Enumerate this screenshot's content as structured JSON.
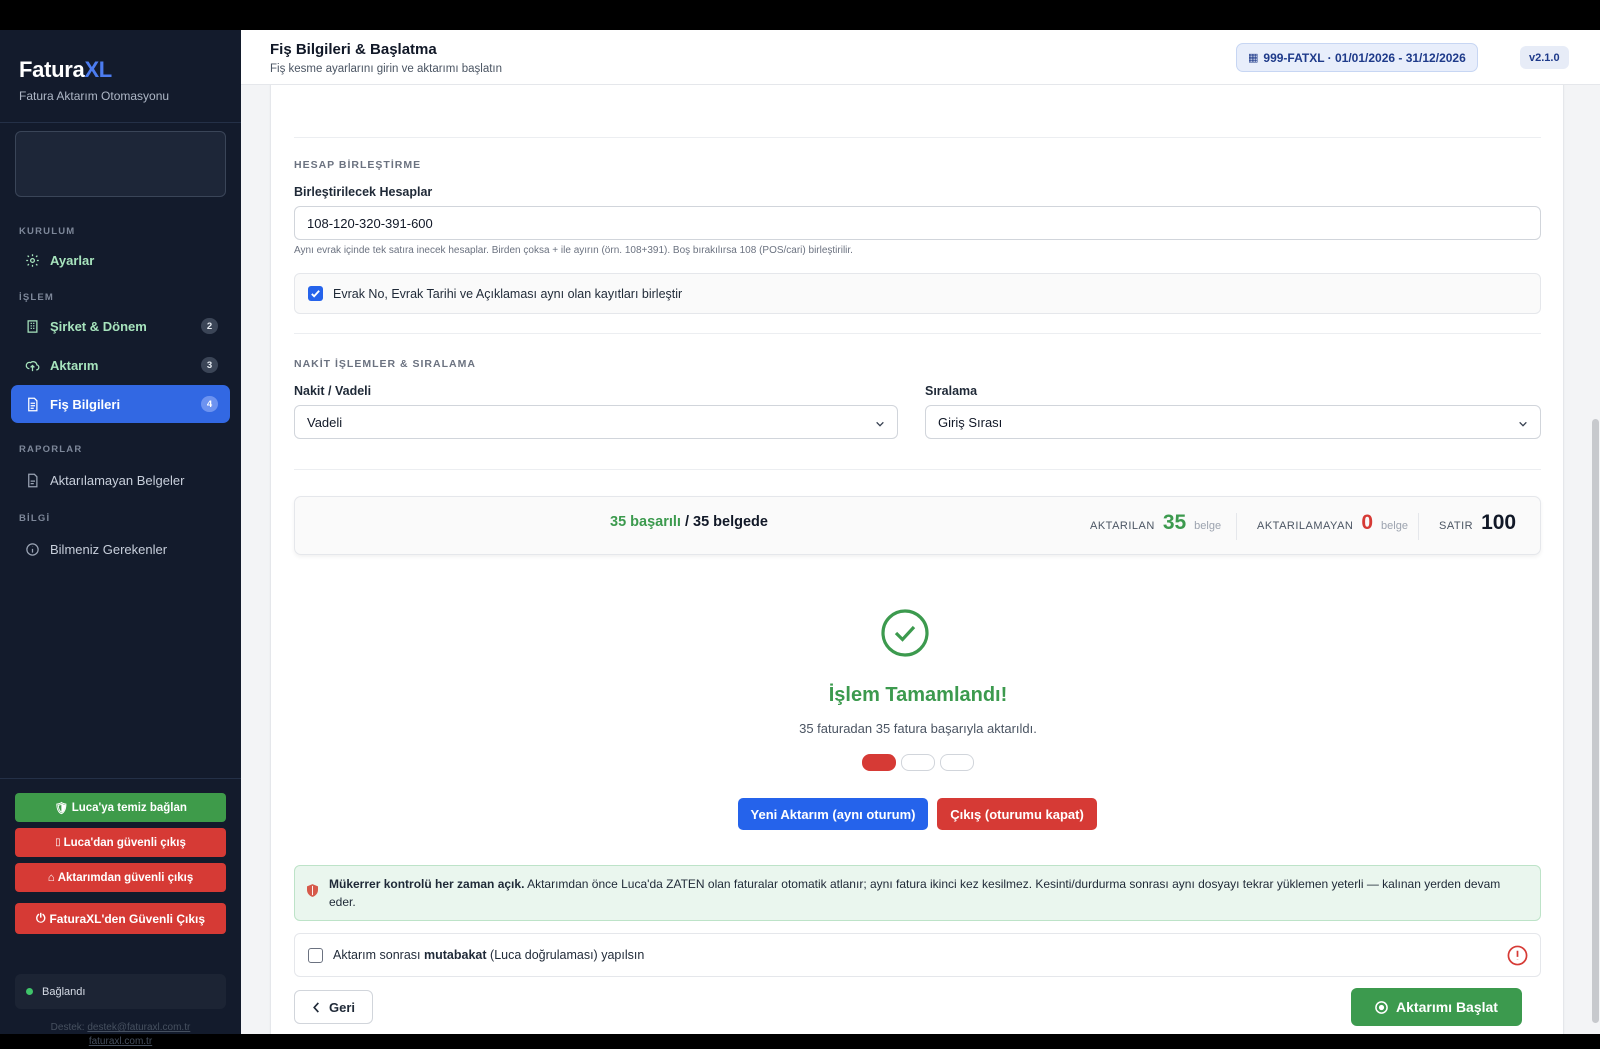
{
  "sidebar": {
    "brand_main": "Fatura",
    "brand_accent": "XL",
    "brand_sub": "Fatura Aktarım Otomasyonu",
    "sections": {
      "setup": "KURULUM",
      "process": "İŞLEM",
      "reports": "RAPORLAR",
      "info": "BİLGİ"
    },
    "items": [
      {
        "label": "Ayarlar",
        "icon": "gear-icon"
      },
      {
        "label": "Şirket & Dönem",
        "icon": "building-icon",
        "badge": "2"
      },
      {
        "label": "Aktarım",
        "icon": "upload-cloud-icon",
        "badge": "3"
      },
      {
        "label": "Fiş Bilgileri",
        "icon": "document-icon",
        "badge": "4",
        "active": true
      },
      {
        "label": "Aktarılamayan Belgeler",
        "icon": "file-icon"
      },
      {
        "label": "Bilmeniz Gerekenler",
        "icon": "info-icon"
      }
    ],
    "buttons": {
      "connect": "Luca'ya temiz bağlan",
      "luca_exit": "Luca'dan güvenli çıkış",
      "transfer_exit": "Aktarımdan güvenli çıkış",
      "app_exit": "FaturaXL'den Güvenli Çıkış"
    },
    "status": "Bağlandı",
    "footer_prefix": "Destek:",
    "footer_email": "destek@faturaxl.com.tr",
    "footer_site": "faturaxl.com.tr"
  },
  "header": {
    "title": "Fiş Bilgileri & Başlatma",
    "subtitle": "Fiş kesme ayarlarını girin ve aktarımı başlatın",
    "company_chip": "999-FATXL · 01/01/2026 - 31/12/2026",
    "version": "v2.1.0"
  },
  "merge": {
    "section_title": "HESAP BİRLEŞTİRME",
    "accounts_label": "Birleştirilecek Hesaplar",
    "accounts_value": "108-120-320-391-600",
    "hint": "Aynı evrak içinde tek satıra inecek hesaplar. Birden çoksa + ile ayırın (örn. 108+391). Boş bırakılırsa 108 (POS/cari) birleştirilir.",
    "checkbox_label": "Evrak No, Evrak Tarihi ve Açıklaması aynı olan kayıtları birleştir",
    "checkbox_checked": true
  },
  "cash": {
    "section_title": "NAKİT İŞLEMLER & SIRALAMA",
    "type_label": "Nakit / Vadeli",
    "type_value": "Vadeli",
    "order_label": "Sıralama",
    "order_value": "Giriş Sırası"
  },
  "stats": {
    "success_text": "35 başarılı",
    "total_text": "/ 35 belgede",
    "transferred_label": "AKTARILAN",
    "transferred_value": "35",
    "failed_label": "AKTARILAMAYAN",
    "failed_value": "0",
    "unit": "belge",
    "rows_label": "SATIR",
    "rows_value": "100"
  },
  "result": {
    "title": "İşlem Tamamlandı!",
    "message": "35 faturadan 35 fatura başarıyla aktarıldı.",
    "new_transfer_button": "Yeni Aktarım (aynı oturum)",
    "exit_button": "Çıkış (oturumu kapat)"
  },
  "alert": {
    "bold": "Mükerrer kontrolü her zaman açık.",
    "text": "Aktarımdan önce Luca'da ZATEN olan faturalar otomatik atlanır; aynı fatura ikinci kez kesilmez. Kesinti/durdurma sonrası aynı dosyayı tekrar yüklemen yeterli — kalınan yerden devam eder."
  },
  "reconcile": {
    "prefix": "Aktarım sonrası",
    "bold": "mutabakat",
    "suffix": "(Luca doğrulaması) yapılsın",
    "checked": false
  },
  "footer_buttons": {
    "back": "Geri",
    "start": "Aktarımı Başlat"
  },
  "colors": {
    "accent_blue": "#2563eb",
    "success_green": "#3c9a4e",
    "danger_red": "#d63a35",
    "sidebar_bg": "#131b2c"
  }
}
